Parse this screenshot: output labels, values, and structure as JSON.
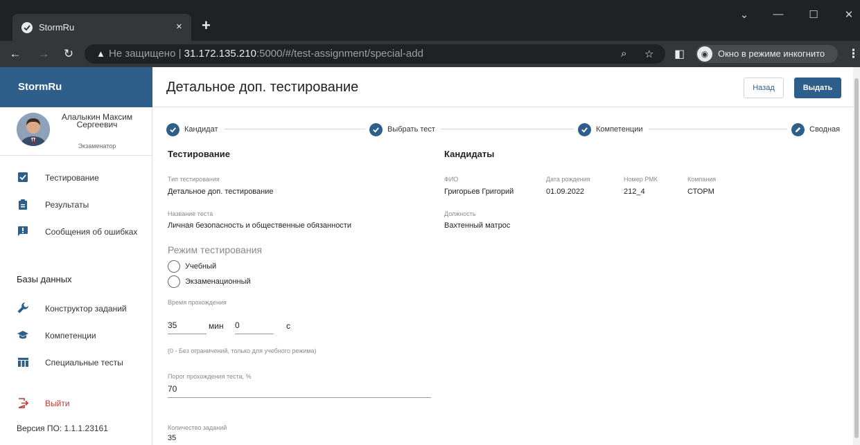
{
  "browser": {
    "tab_title": "StormRu",
    "tab_close": "×",
    "new_tab": "+",
    "url_warning": "Не защищено",
    "url_host": "31.172.135.210",
    "url_rest": ":5000/#/test-assignment/special-add",
    "incognito_label": "Окно в режиме инкогнито"
  },
  "sidebar": {
    "brand": "StormRu",
    "user": {
      "name": "Алалыкин Максим Сергеевич",
      "role": "Экзаменатор"
    },
    "items": [
      {
        "label": "Тестирование",
        "icon": "checkbox-icon"
      },
      {
        "label": "Результаты",
        "icon": "clipboard-icon"
      },
      {
        "label": "Сообщения об ошибках",
        "icon": "alert-message-icon"
      }
    ],
    "db_title": "Базы данных",
    "db_items": [
      {
        "label": "Конструктор заданий",
        "icon": "wrench-icon"
      },
      {
        "label": "Компетенции",
        "icon": "graduation-cap-icon"
      },
      {
        "label": "Специальные тесты",
        "icon": "table-icon"
      }
    ],
    "logout": "Выйти",
    "version": "Версия ПО: 1.1.1.23161"
  },
  "header": {
    "title": "Детальное доп. тестирование",
    "back_label": "Назад",
    "issue_label": "Выдать"
  },
  "stepper": {
    "steps": [
      "Кандидат",
      "Выбрать тест",
      "Компетенции",
      "Сводная"
    ]
  },
  "testing": {
    "section_title": "Тестирование",
    "type_label": "Тип тестирования",
    "type_value": "Детальное доп. тестирование",
    "name_label": "Название теста",
    "name_value": "Личная безопасность и общественные обязанности",
    "mode_title": "Режим тестирования",
    "mode_options": [
      "Учебный",
      "Экзаменационный"
    ],
    "time_label": "Время прохождения",
    "minutes": "35",
    "minutes_unit": "мин",
    "seconds": "0",
    "seconds_unit": "с",
    "time_hint": "(0 - Без ограничений, только для учебного режима)",
    "threshold_label": "Порог прохождения теста, %",
    "threshold_value": "70",
    "count_label": "Количество заданий",
    "count_value": "35"
  },
  "candidates": {
    "section_title": "Кандидаты",
    "headers": [
      "ФИО",
      "Дата рождения",
      "Номер РМК",
      "Компания"
    ],
    "row": [
      "Григорьев Григорий",
      "01.09.2022",
      "212_4",
      "СТОРМ"
    ],
    "position_label": "Должность",
    "position_value": "Вахтенный матрос"
  },
  "colors": {
    "brand": "#2e5f8a",
    "logout": "#c0392b"
  }
}
